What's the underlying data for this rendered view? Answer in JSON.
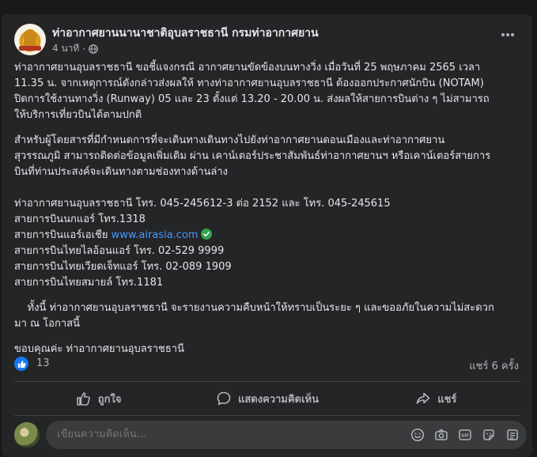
{
  "post": {
    "page_name": "ท่าอากาศยานนานาชาติอุบลราชธานี กรมท่าอากาศยาน",
    "time": "4 นาที",
    "audience_icon": "globe-icon",
    "more_icon": "more-horizontal-icon",
    "paragraph1": [
      "ท่าอากาศยานอุบลราชธานี ขอชี้แจงกรณี อากาศยานขัดข้องบนทางวิ่ง  เมื่อวันที่ 25 พฤษภาคม 2565 เวลา",
      "11.35 น.  จากเหตุการณ์ดังกล่าวส่งผลให้ ทางท่าอากาศยานอุบลราชธานี ต้องออกประกาศนักบิน (NOTAM)",
      "ปิดการใช้งานทางวิ่ง (Runway)  05 และ 23  ตั้งแต่ 13.20 - 20.00 น. ส่งผลให้สายการบินต่าง ๆ ไม่สามารถ",
      "ให้บริการเที่ยวบินได้ตามปกติ"
    ],
    "paragraph2": [
      "สำหรับผู้โดยสารที่มีกำหนดการที่จะเดินทางเดินทางไปยังท่าอากาศยานดอนเมืองและท่าอากาศยาน",
      "สุวรรณภูมิ สามารถติดต่อข้อมูลเพิ่มเติม ผ่าน เคาน์เตอร์ประชาสัมพันธ์ท่าอากาศยานฯ หรือเคาน์เตอร์สายการ",
      "บินที่ท่านประสงค์จะเดินทางตามช่องทางด้านล่าง"
    ],
    "contact_airport": "ท่าอากาศยานอุบลราชธานี โทร. 045-245612-3 ต่อ 2152 และ โทร. 045-245615",
    "contact_nokair": "สายการบินนกแอร์ โทร.1318",
    "contact_airasia_prefix": "สายการบินแอร์เอเชีย ",
    "contact_airasia_link": "www.airasia.com",
    "contact_thailion": "สายการบินไทยไลอ้อนแอร์ โทร. 02-529 9999",
    "contact_vietjet": "สายการบินไทยเวียดเจ็ทแอร์ โทร. 02-089 1909",
    "contact_smile": "สายการบินไทยสมายล์ โทร.1181",
    "paragraph3": [
      "    ทั้งนี้ ท่าอากาศยานอุบลราชธานี จะรายงานความคืบหน้าให้ทราบเป็นระยะ ๆ และขออภัยในความไม่สะดวก",
      "มา ณ โอกาสนี้"
    ],
    "closing": "ขอบคุณค่ะ  ท่าอากาศยานอุบลราชธานี"
  },
  "stats": {
    "like_count": "13",
    "shares": "แชร์ 6 ครั้ง"
  },
  "actions": {
    "like_label": "ถูกใจ",
    "comment_label": "แสดงความคิดเห็น",
    "share_label": "แชร์"
  },
  "comment": {
    "placeholder": "เขียนความคิดเห็น...",
    "tools": [
      "smiley-icon",
      "camera-icon",
      "gif-icon",
      "sticker-icon",
      "more-icon"
    ]
  },
  "colors": {
    "background": "#18191a",
    "card": "#242526",
    "link": "#4599ff",
    "like_blue": "#1877f2",
    "verified_green": "#31a24c"
  }
}
